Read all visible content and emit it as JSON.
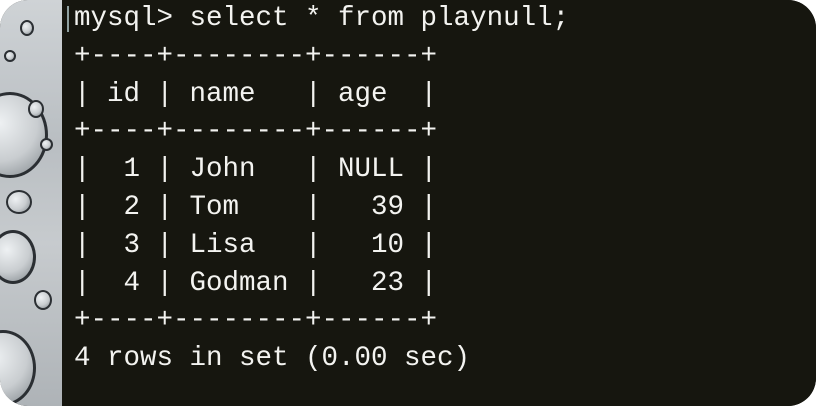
{
  "terminal": {
    "lines": [
      "mysql> select * from playnull;",
      "+----+--------+------+",
      "| id | name   | age  |",
      "+----+--------+------+",
      "|  1 | John   | NULL |",
      "|  2 | Tom    |   39 |",
      "|  3 | Lisa   |   10 |",
      "|  4 | Godman |   23 |",
      "+----+--------+------+",
      "4 rows in set (0.00 sec)"
    ]
  },
  "query": {
    "prompt": "mysql>",
    "command": "select * from playnull;"
  },
  "result_table": {
    "columns": [
      "id",
      "name",
      "age"
    ],
    "rows": [
      [
        "1",
        "John",
        "NULL"
      ],
      [
        "2",
        "Tom",
        "39"
      ],
      [
        "3",
        "Lisa",
        "10"
      ],
      [
        "4",
        "Godman",
        "23"
      ]
    ],
    "summary": "4 rows in set (0.00 sec)"
  },
  "colors": {
    "background": "#16160f",
    "text": "#f3f3f0"
  }
}
